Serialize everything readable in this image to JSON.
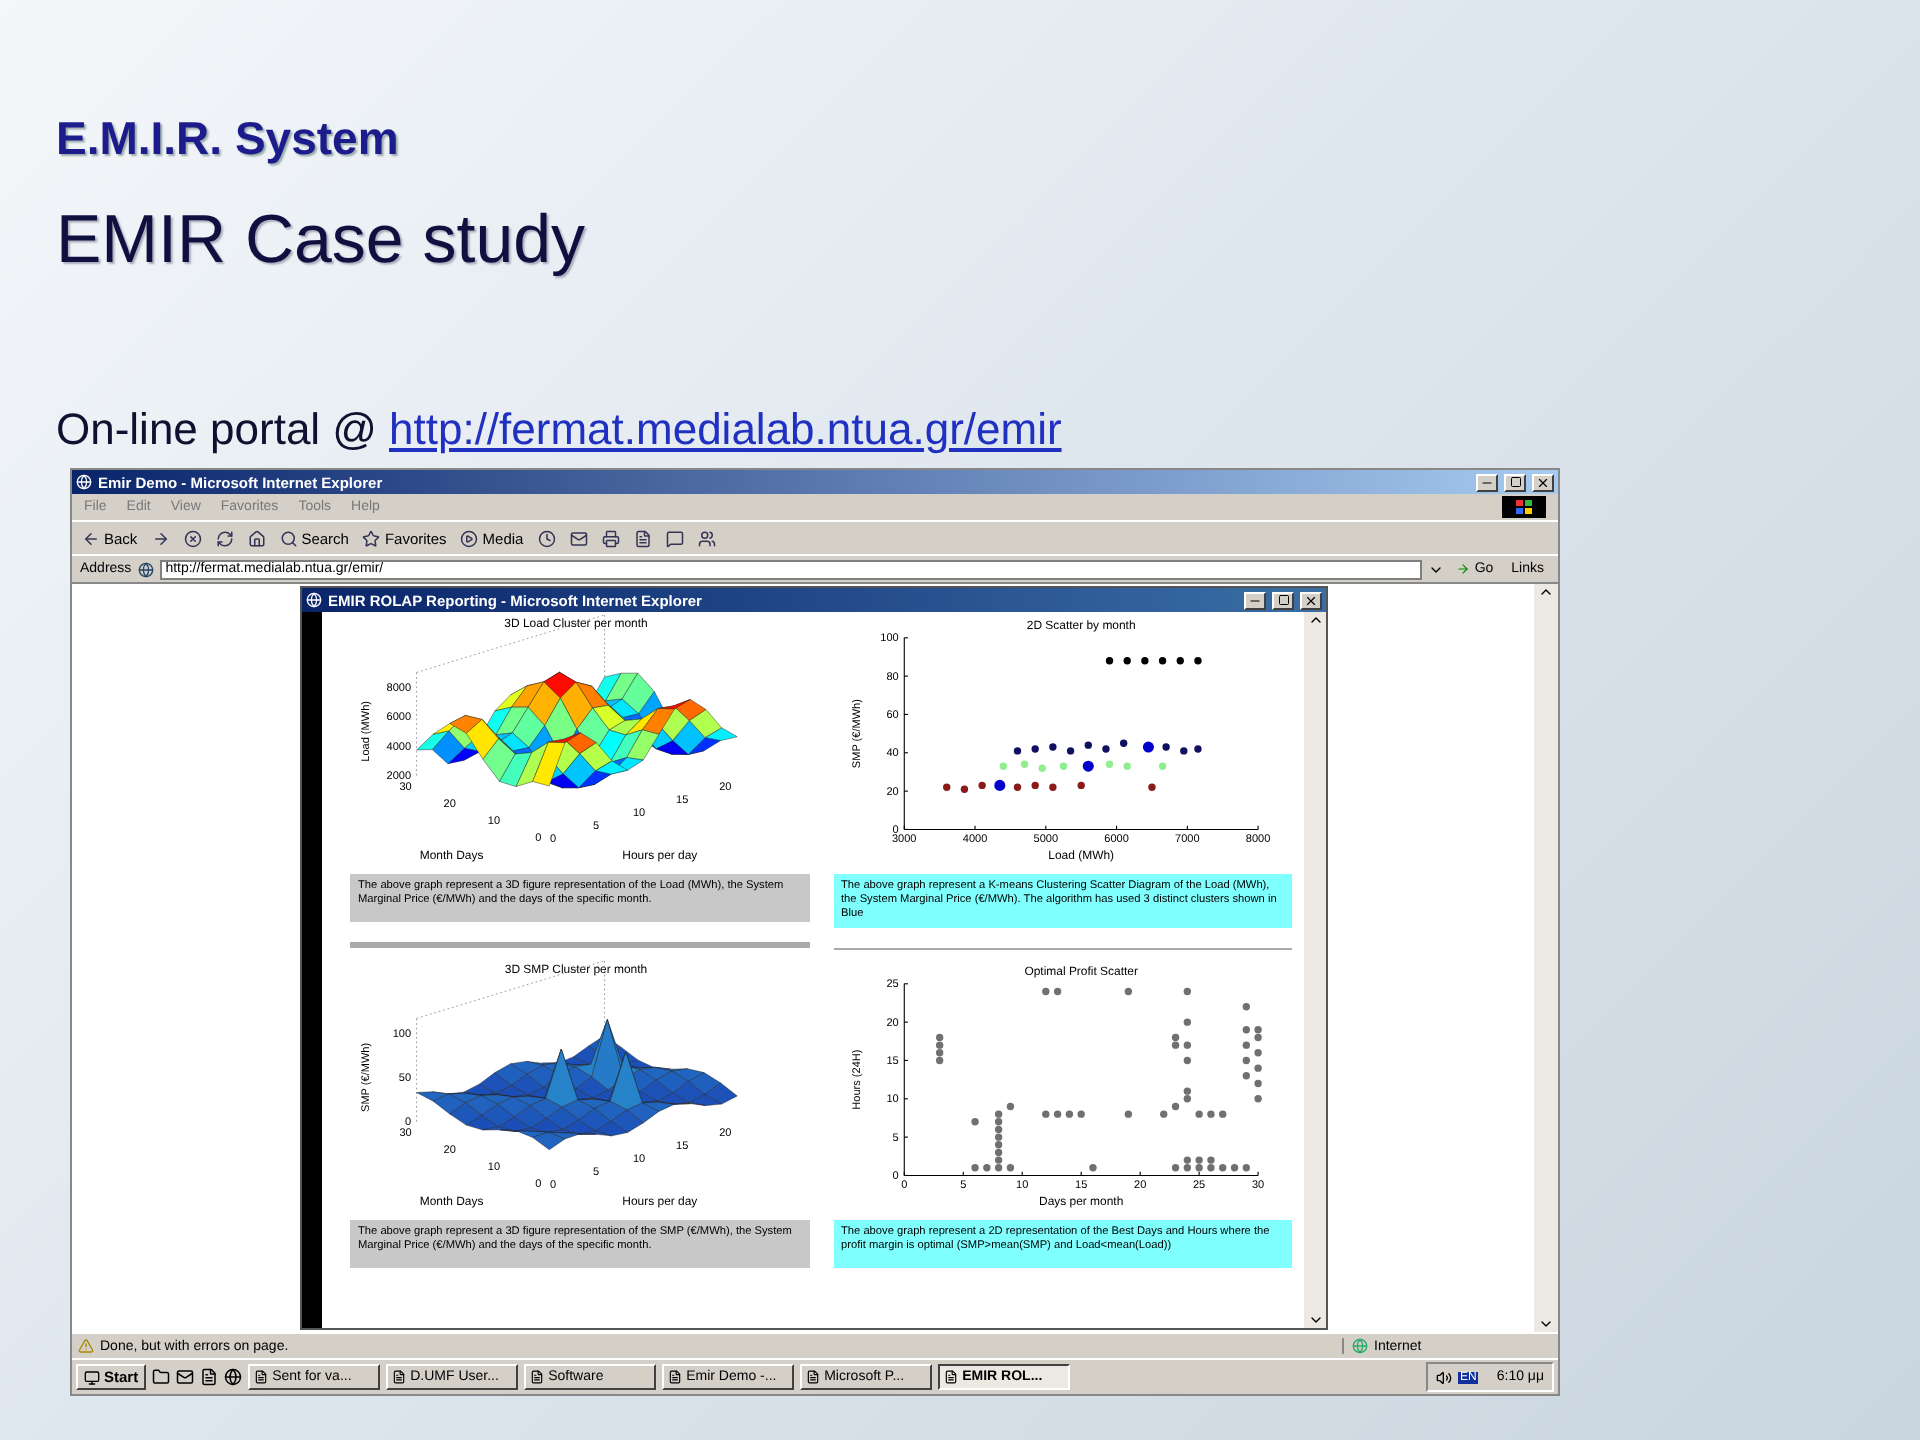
{
  "slide": {
    "subtitle": "E.M.I.R. System",
    "title": "EMIR Case study",
    "portal_label": "On-line portal @",
    "portal_link": "http://fermat.medialab.ntua.gr/emir"
  },
  "browser": {
    "title": "Emir Demo - Microsoft Internet Explorer",
    "menu": [
      "File",
      "Edit",
      "View",
      "Favorites",
      "Tools",
      "Help"
    ],
    "toolbar": [
      {
        "kind": "back",
        "label": "Back"
      },
      {
        "kind": "forward"
      },
      {
        "kind": "stop"
      },
      {
        "kind": "refresh"
      },
      {
        "kind": "home"
      },
      {
        "kind": "search",
        "label": "Search"
      },
      {
        "kind": "favorites",
        "label": "Favorites"
      },
      {
        "kind": "media",
        "label": "Media"
      },
      {
        "kind": "history"
      },
      {
        "kind": "mail"
      },
      {
        "kind": "print"
      },
      {
        "kind": "edit"
      },
      {
        "kind": "discuss"
      },
      {
        "kind": "messenger"
      }
    ],
    "address_label": "Address",
    "url": "http://fermat.medialab.ntua.gr/emir/",
    "go": "Go",
    "links": "Links",
    "status": "Done, but with errors on page.",
    "zone": "Internet"
  },
  "popup": {
    "title": "EMIR ROLAP Reporting - Microsoft Internet Explorer",
    "panels": [
      {
        "kind": "surface",
        "title": "3D Load Cluster per month",
        "zlabel": "Load (MWh)",
        "zticks": [
          "8000",
          "6000",
          "4000",
          "2000"
        ],
        "ylabel": "Month Days",
        "yticks": [
          "30",
          "20",
          "10",
          "0"
        ],
        "xlabel": "Hours per day",
        "xticks": [
          "0",
          "5",
          "10",
          "15",
          "20"
        ],
        "caption": "The above graph represent a 3D figure representation of the Load (MWh), the System Marginal Price (€/MWh) and the days of the specific month.",
        "color": "#c8c8c8"
      },
      {
        "kind": "scatter",
        "caption": "The above graph represent a K-means Clustering Scatter Diagram of the Load (MWh), the System Marginal Price (€/MWh). The algorithm has used 3 distinct clusters shown in Blue",
        "color": "#80ffff",
        "chart_data": {
          "type": "scatter",
          "title": "2D Scatter by month",
          "xlabel": "Load (MWh)",
          "ylabel": "SMP (€/MWh)",
          "xlim": [
            3000,
            8000
          ],
          "ylim": [
            0,
            100
          ],
          "xticks": [
            3000,
            4000,
            5000,
            6000,
            7000,
            8000
          ],
          "yticks": [
            0,
            20,
            40,
            60,
            80,
            100
          ],
          "series": [
            {
              "color": "#8b1a1a",
              "x": [
                3600,
                3850,
                4100,
                4600,
                4850,
                5100,
                5500,
                6500
              ],
              "values": [
                22,
                21,
                23,
                22,
                23,
                22,
                23,
                22
              ]
            },
            {
              "color": "#90ee90",
              "x": [
                4400,
                4700,
                4950,
                5250,
                5900,
                6150,
                6650
              ],
              "values": [
                33,
                34,
                32,
                33,
                34,
                33,
                33
              ]
            },
            {
              "color": "#101060",
              "x": [
                4600,
                4850,
                5100,
                5350,
                5600,
                5850,
                6100,
                6700,
                6950,
                7150
              ],
              "values": [
                41,
                42,
                43,
                41,
                44,
                42,
                45,
                43,
                41,
                42
              ]
            },
            {
              "color": "#000000",
              "x": [
                5900,
                6150,
                6400,
                6650,
                6900,
                7150
              ],
              "values": [
                88,
                88,
                88,
                88,
                88,
                88
              ]
            },
            {
              "color": "#0000cc",
              "x": [
                4350,
                5600,
                6450
              ],
              "values": [
                23,
                33,
                43
              ]
            }
          ]
        }
      },
      {
        "kind": "surface",
        "title": "3D SMP Cluster per month",
        "zlabel": "SMP (€/MWh)",
        "zticks": [
          "100",
          "50",
          "0"
        ],
        "ylabel": "Month Days",
        "yticks": [
          "30",
          "20",
          "10",
          "0"
        ],
        "xlabel": "Hours per day",
        "xticks": [
          "0",
          "5",
          "10",
          "15",
          "20"
        ],
        "caption": "The above graph represent a 3D figure representation of the SMP (€/MWh), the System Marginal Price (€/MWh) and the days of the specific month.",
        "color": "#c8c8c8"
      },
      {
        "kind": "scatter",
        "caption": "The above graph represent a 2D representation of the Best Days and Hours where the profit margin is optimal (SMP>mean(SMP) and Load<mean(Load))",
        "color": "#80ffff",
        "chart_data": {
          "type": "scatter",
          "title": "Optimal Profit Scatter",
          "xlabel": "Days per month",
          "ylabel": "Hours (24H)",
          "xlim": [
            0,
            30
          ],
          "ylim": [
            0,
            25
          ],
          "xticks": [
            0,
            5,
            10,
            15,
            20,
            25,
            30
          ],
          "yticks": [
            0,
            5,
            10,
            15,
            20,
            25
          ],
          "series": [
            {
              "color": "#707070",
              "x": [
                3,
                3,
                3,
                3,
                6,
                6,
                7,
                8,
                8,
                8,
                8,
                8,
                8,
                8,
                8,
                9,
                9,
                12,
                12,
                13,
                13,
                14,
                15,
                16,
                19,
                19,
                22,
                23,
                23,
                23,
                23,
                24,
                24,
                24,
                24,
                24,
                24,
                24,
                24,
                25,
                25,
                25,
                26,
                26,
                26,
                27,
                27,
                28,
                29,
                29,
                29,
                29,
                29,
                29,
                30,
                30,
                30,
                30,
                30,
                30
              ],
              "values": [
                15,
                16,
                17,
                18,
                1,
                7,
                1,
                1,
                2,
                3,
                4,
                5,
                6,
                7,
                8,
                1,
                9,
                8,
                24,
                24,
                8,
                8,
                8,
                1,
                8,
                24,
                8,
                1,
                9,
                17,
                18,
                1,
                2,
                10,
                11,
                15,
                17,
                20,
                24,
                1,
                2,
                8,
                1,
                2,
                8,
                1,
                8,
                1,
                1,
                13,
                15,
                17,
                19,
                22,
                10,
                12,
                14,
                16,
                18,
                19
              ]
            }
          ]
        }
      }
    ]
  },
  "taskbar": {
    "start": "Start",
    "tasks": [
      {
        "label": "Sent for va...",
        "selected": false
      },
      {
        "label": "D.UMF User...",
        "selected": false
      },
      {
        "label": "Software",
        "selected": false
      },
      {
        "label": "Emir Demo -...",
        "selected": false
      },
      {
        "label": "Microsoft P...",
        "selected": false
      },
      {
        "label": "EMIR ROL...",
        "selected": true
      }
    ],
    "lang": "EN",
    "clock": "6:10 μμ"
  }
}
